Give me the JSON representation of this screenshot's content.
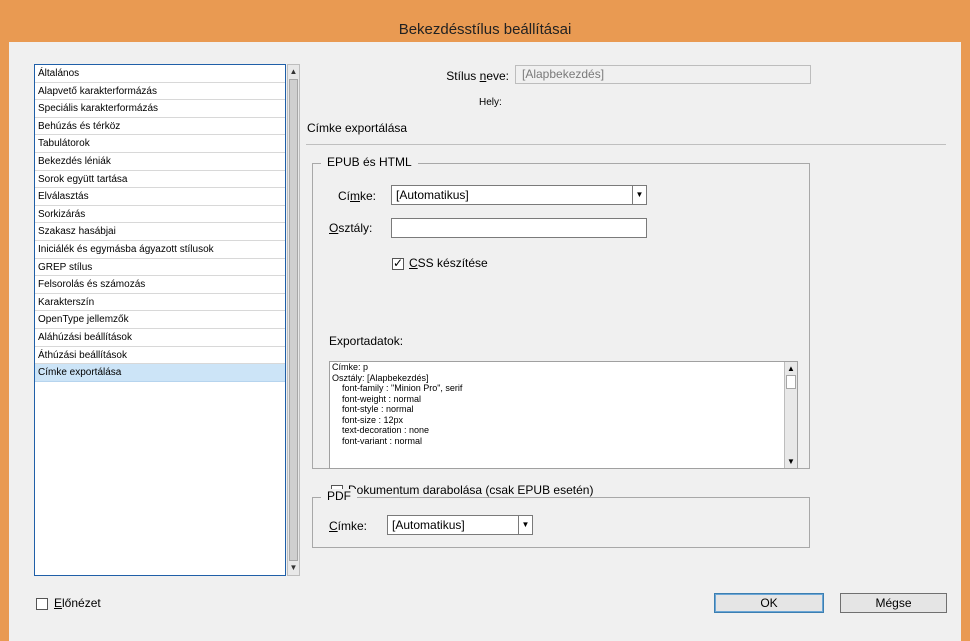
{
  "window": {
    "title": "Bekezdésstílus beállításai"
  },
  "sidebar": {
    "items": [
      {
        "label": "Általános",
        "selected": false
      },
      {
        "label": "Alapvető karakterformázás",
        "selected": false
      },
      {
        "label": "Speciális karakterformázás",
        "selected": false
      },
      {
        "label": "Behúzás és térköz",
        "selected": false
      },
      {
        "label": "Tabulátorok",
        "selected": false
      },
      {
        "label": "Bekezdés léniák",
        "selected": false
      },
      {
        "label": "Sorok együtt tartása",
        "selected": false
      },
      {
        "label": "Elválasztás",
        "selected": false
      },
      {
        "label": "Sorkizárás",
        "selected": false
      },
      {
        "label": "Szakasz hasábjai",
        "selected": false
      },
      {
        "label": "Iniciálék és egymásba ágyazott stílusok",
        "selected": false
      },
      {
        "label": "GREP stílus",
        "selected": false
      },
      {
        "label": "Felsorolás és számozás",
        "selected": false
      },
      {
        "label": "Karakterszín",
        "selected": false
      },
      {
        "label": "OpenType jellemzők",
        "selected": false
      },
      {
        "label": "Aláhúzási beállítások",
        "selected": false
      },
      {
        "label": "Áthúzási beállítások",
        "selected": false
      },
      {
        "label": "Címke exportálása",
        "selected": true
      }
    ]
  },
  "header": {
    "style_name_label_pre": "Stílus ",
    "style_name_label_u": "n",
    "style_name_label_post": "eve:",
    "style_name_value": "[Alapbekezdés]",
    "location_label": "Hely:"
  },
  "main": {
    "section_title": "Címke exportálása",
    "epub": {
      "title": "EPUB és HTML",
      "tag_label_pre": "Cí",
      "tag_label_u": "m",
      "tag_label_post": "ke:",
      "tag_value": "[Automatikus]",
      "class_label_u": "O",
      "class_label_post": "sztály:",
      "class_value": "",
      "css_checkbox_u": "C",
      "css_checkbox_post": "SS készítése",
      "css_checked": true,
      "export_data_label": "Exportadatok:",
      "export_lines": [
        "Címke: p",
        "Osztály: [Alapbekezdés]",
        "    font-family : \"Minion Pro\", serif",
        "    font-weight : normal",
        "    font-style : normal",
        "    font-size : 12px",
        "    text-decoration : none",
        "    font-variant : normal"
      ],
      "split_checkbox_u": "D",
      "split_checkbox_post": "okumentum darabolása (csak EPUB esetén)",
      "split_checked": false
    },
    "pdf": {
      "title": "PDF",
      "tag_label_u": "C",
      "tag_label_post": "ímke:",
      "tag_value": "[Automatikus]"
    }
  },
  "footer": {
    "preview_label_u": "E",
    "preview_label_post": "lőnézet",
    "preview_checked": false,
    "ok_label": "OK",
    "cancel_label": "Mégse"
  }
}
